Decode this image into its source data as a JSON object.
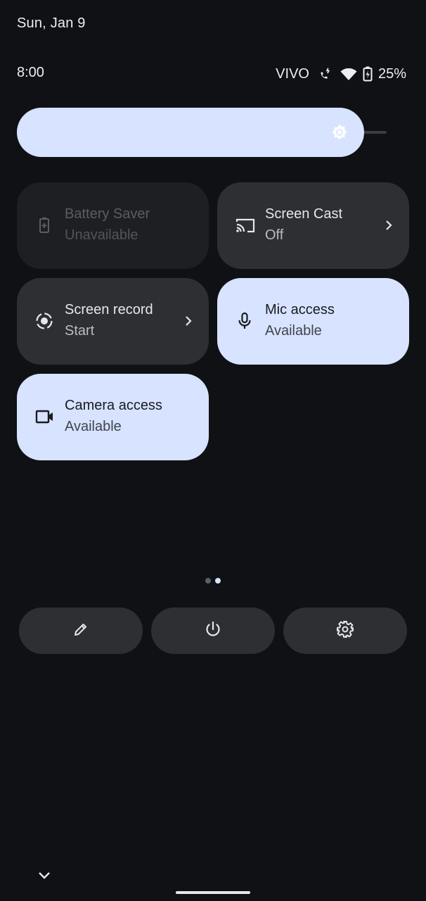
{
  "header": {
    "date": "Sun, Jan 9",
    "time": "8:00",
    "carrier": "VIVO",
    "battery_percent": "25%"
  },
  "brightness": {
    "level": 0.94,
    "icon": "brightness-sun-icon"
  },
  "tiles": [
    {
      "label": "Battery Saver",
      "sub": "Unavailable",
      "state": "disabled",
      "icon": "battery-saver-icon"
    },
    {
      "label": "Screen Cast",
      "sub": "Off",
      "state": "off",
      "icon": "cast-icon",
      "chevron": true
    },
    {
      "label": "Screen record",
      "sub": "Start",
      "state": "off",
      "icon": "screen-record-icon",
      "chevron": true
    },
    {
      "label": "Mic access",
      "sub": "Available",
      "state": "on",
      "icon": "mic-icon"
    },
    {
      "label": "Camera access",
      "sub": "Available",
      "state": "on",
      "icon": "camera-icon"
    }
  ],
  "pager": {
    "pages": 2,
    "active": 2
  },
  "bottom_actions": [
    {
      "name": "edit",
      "icon": "pencil-icon"
    },
    {
      "name": "power",
      "icon": "power-icon"
    },
    {
      "name": "settings",
      "icon": "gear-icon"
    }
  ],
  "colors": {
    "background": "#0f1115",
    "tile_off": "#2d2f33",
    "tile_on": "#d7e3ff",
    "tile_disabled": "#1d1f23"
  }
}
